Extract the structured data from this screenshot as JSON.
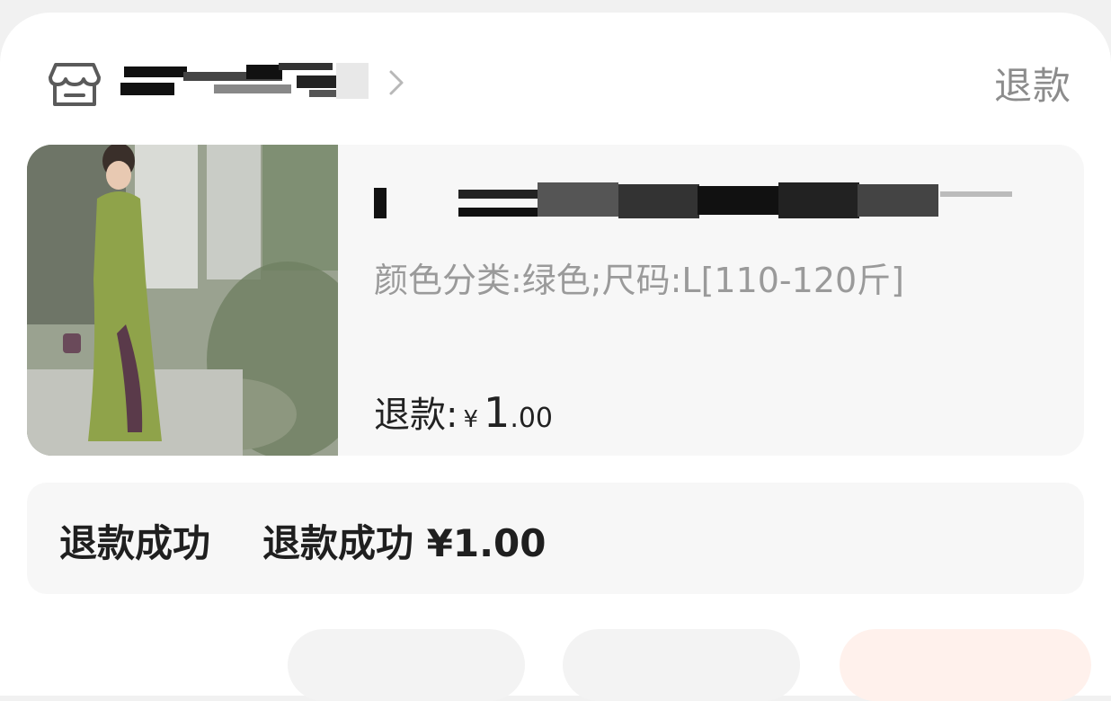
{
  "header": {
    "shop_icon": "store-icon",
    "chevron_icon": "chevron-right-icon",
    "status_tag": "退款"
  },
  "product": {
    "thumbnail_alt": "product-thumbnail",
    "spec": "颜色分类:绿色;尺码:L[110-120斤]",
    "refund_label": "退款:",
    "currency": "¥",
    "amount_int": "1",
    "amount_dec": ".00"
  },
  "status": {
    "title": "退款成功",
    "description": "退款成功 ¥1.00"
  },
  "colors": {
    "background": "#f1f1f1",
    "card": "#ffffff",
    "panel": "#f7f7f7",
    "muted_text": "#9a9a9a",
    "primary_text": "#1f1f1f"
  }
}
